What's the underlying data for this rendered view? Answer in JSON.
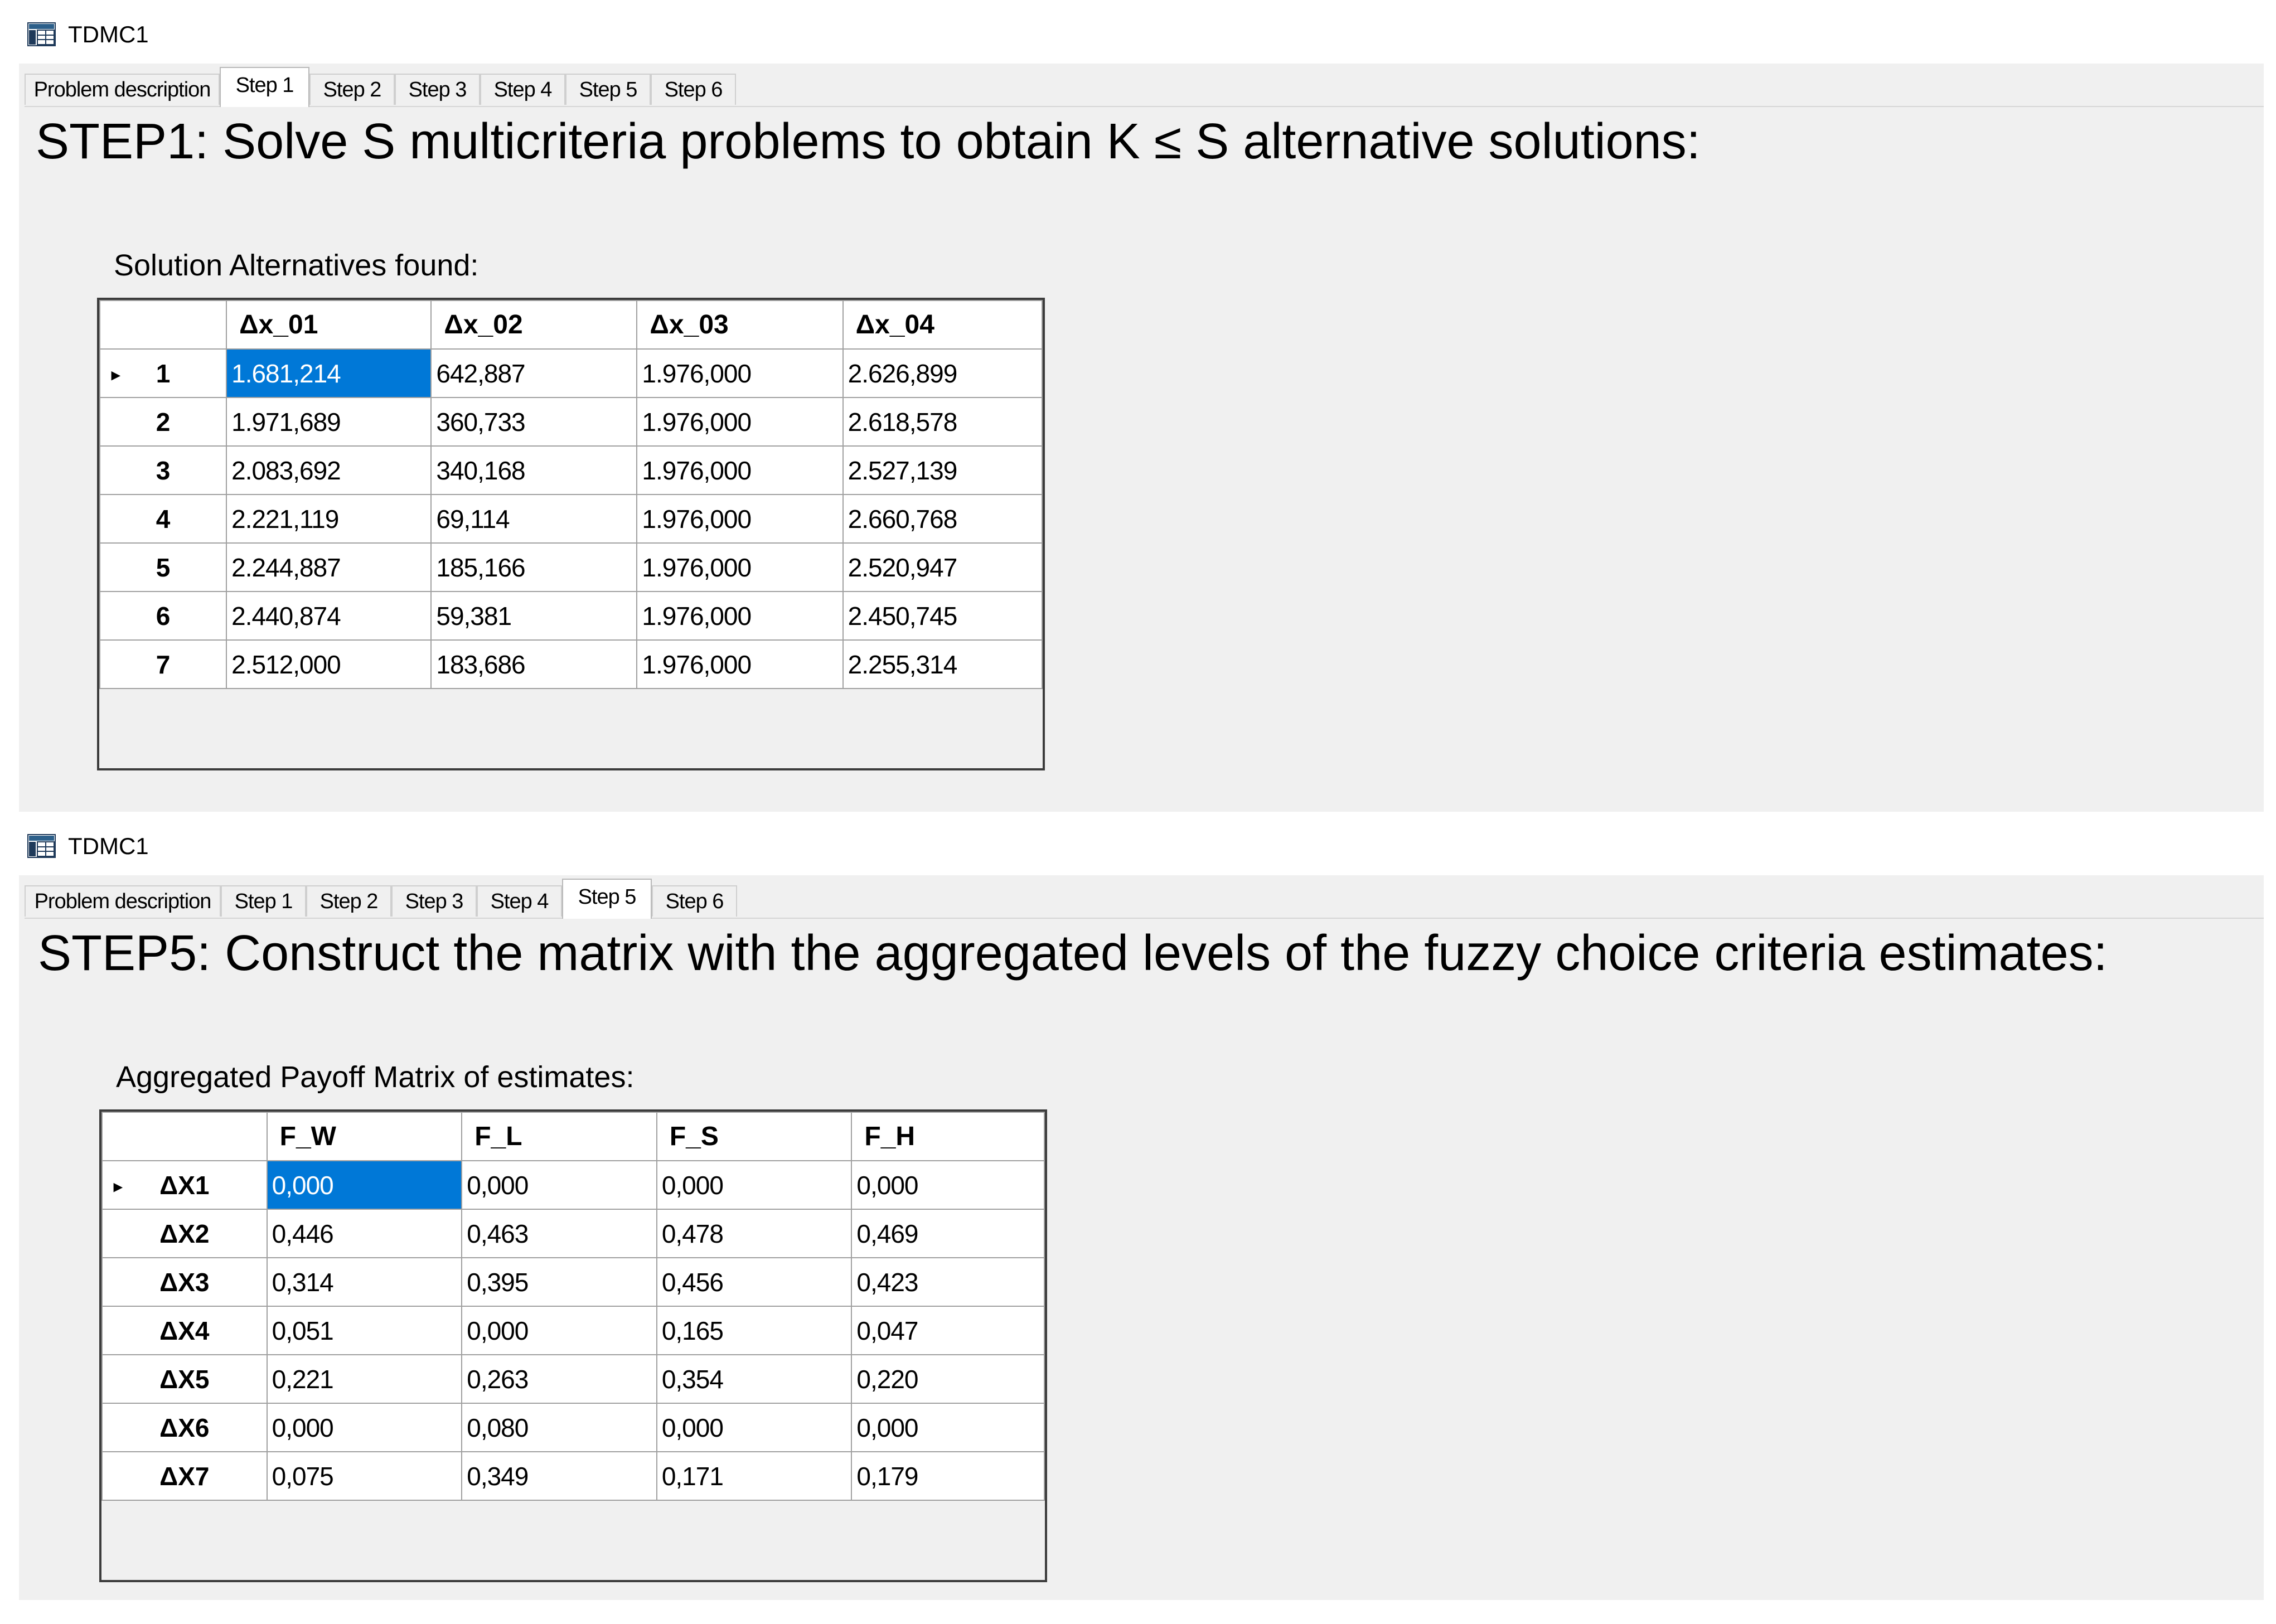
{
  "windows": [
    {
      "title": "TDMC1",
      "tabs": [
        "Problem description",
        "Step 1",
        "Step 2",
        "Step 3",
        "Step 4",
        "Step 5",
        "Step 6"
      ],
      "active_tab": "Step 1",
      "heading": "STEP1: Solve S multicriteria problems to obtain K ≤ S alternative solutions:",
      "grid_caption": "Solution Alternatives found:",
      "grid": {
        "columns": [
          "Δx_01",
          "Δx_02",
          "Δx_03",
          "Δx_04"
        ],
        "rows": [
          {
            "label": "1",
            "values": [
              "1.681,214",
              "642,887",
              "1.976,000",
              "2.626,899"
            ]
          },
          {
            "label": "2",
            "values": [
              "1.971,689",
              "360,733",
              "1.976,000",
              "2.618,578"
            ]
          },
          {
            "label": "3",
            "values": [
              "2.083,692",
              "340,168",
              "1.976,000",
              "2.527,139"
            ]
          },
          {
            "label": "4",
            "values": [
              "2.221,119",
              "69,114",
              "1.976,000",
              "2.660,768"
            ]
          },
          {
            "label": "5",
            "values": [
              "2.244,887",
              "185,166",
              "1.976,000",
              "2.520,947"
            ]
          },
          {
            "label": "6",
            "values": [
              "2.440,874",
              "59,381",
              "1.976,000",
              "2.450,745"
            ]
          },
          {
            "label": "7",
            "values": [
              "2.512,000",
              "183,686",
              "1.976,000",
              "2.255,314"
            ]
          }
        ],
        "current_row_marker": "▸"
      }
    },
    {
      "title": "TDMC1",
      "tabs": [
        "Problem description",
        "Step 1",
        "Step 2",
        "Step 3",
        "Step 4",
        "Step 5",
        "Step 6"
      ],
      "active_tab": "Step 5",
      "heading": "STEP5: Construct the matrix with the aggregated levels of the fuzzy choice criteria estimates:",
      "grid_caption": "Aggregated Payoff Matrix of estimates:",
      "grid": {
        "columns": [
          "F_W",
          "F_L",
          "F_S",
          "F_H"
        ],
        "rows": [
          {
            "label": "ΔX1",
            "values": [
              "0,000",
              "0,000",
              "0,000",
              "0,000"
            ]
          },
          {
            "label": "ΔX2",
            "values": [
              "0,446",
              "0,463",
              "0,478",
              "0,469"
            ]
          },
          {
            "label": "ΔX3",
            "values": [
              "0,314",
              "0,395",
              "0,456",
              "0,423"
            ]
          },
          {
            "label": "ΔX4",
            "values": [
              "0,051",
              "0,000",
              "0,165",
              "0,047"
            ]
          },
          {
            "label": "ΔX5",
            "values": [
              "0,221",
              "0,263",
              "0,354",
              "0,220"
            ]
          },
          {
            "label": "ΔX6",
            "values": [
              "0,000",
              "0,080",
              "0,000",
              "0,000"
            ]
          },
          {
            "label": "ΔX7",
            "values": [
              "0,075",
              "0,349",
              "0,171",
              "0,179"
            ]
          }
        ],
        "current_row_marker": "▸"
      }
    }
  ]
}
